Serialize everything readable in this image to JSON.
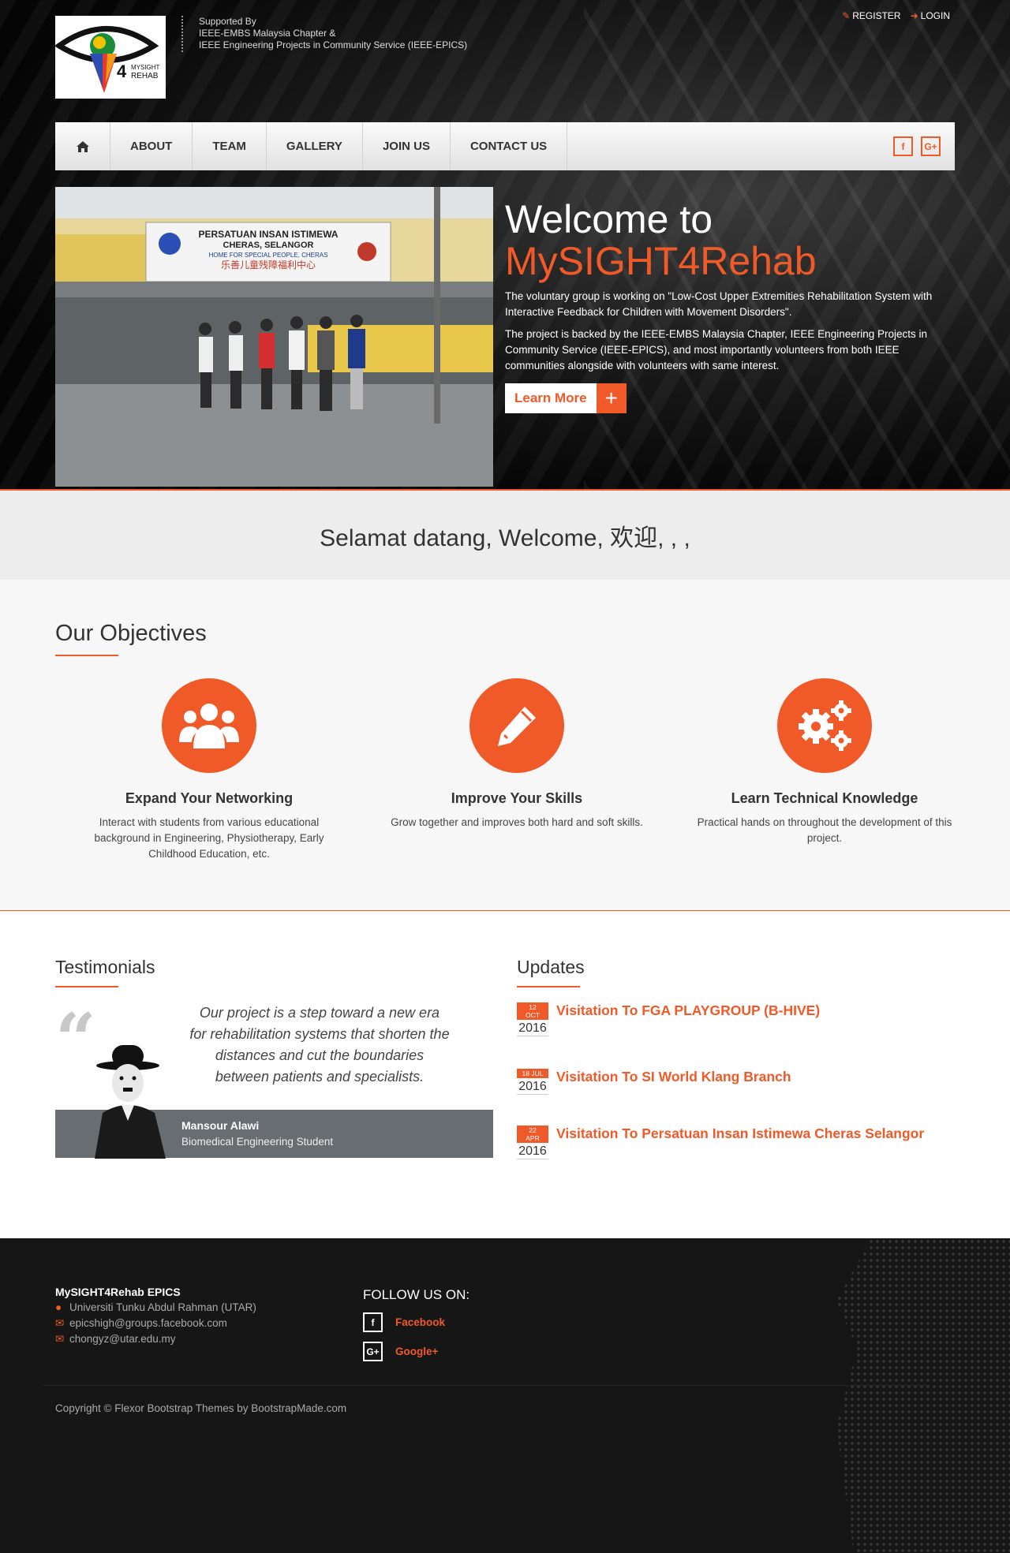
{
  "header": {
    "support_label": "Supported By",
    "support_line1": "IEEE-EMBS Malaysia Chapter &",
    "support_line2": "IEEE Engineering Projects in Community Service (IEEE-EPICS)",
    "logo_line1": "MYSIGHT",
    "logo_line2": "REHAB",
    "logo_number": "4",
    "register_label": "REGISTER",
    "login_label": "LOGIN"
  },
  "nav": {
    "items": [
      {
        "label": "ABOUT"
      },
      {
        "label": "TEAM"
      },
      {
        "label": "GALLERY"
      },
      {
        "label": "JOIN US"
      },
      {
        "label": "CONTACT US"
      }
    ],
    "facebook_glyph": "f",
    "googleplus_glyph": "G+"
  },
  "hero": {
    "title_line1": "Welcome to",
    "title_line2": "MySIGHT4Rehab",
    "para1": "The voluntary group is working on \"Low-Cost Upper Extremities Rehabilitation System with Interactive Feedback for Children with Movement Disorders\".",
    "para2": "The project is backed by the IEEE-EMBS Malaysia Chapter, IEEE Engineering Projects in Community Service (IEEE-EPICS), and most importantly volunteers from both IEEE communities alongside with volunteers with same interest.",
    "button_label": "Learn More",
    "photo_sign_line1": "PERSATUAN INSAN ISTIMEWA",
    "photo_sign_line2": "CHERAS, SELANGOR",
    "photo_sign_line3": "HOME FOR SPECIAL PEOPLE, CHERAS",
    "photo_sign_line4": "乐善儿童残障福利中心"
  },
  "welcome_bar": {
    "text": "Selamat datang, Welcome, 欢迎,         , ,"
  },
  "objectives": {
    "title": "Our Objectives",
    "items": [
      {
        "icon": "users-icon",
        "title": "Expand Your Networking",
        "desc": "Interact with students from various educational background in Engineering, Physiotherapy, Early Childhood Education, etc."
      },
      {
        "icon": "pencil-icon",
        "title": "Improve Your Skills",
        "desc": "Grow together and improves both hard and soft skills."
      },
      {
        "icon": "gears-icon",
        "title": "Learn Technical Knowledge",
        "desc": "Practical hands on throughout the development of this project."
      }
    ]
  },
  "testimonials": {
    "title": "Testimonials",
    "quote": "Our project is a step toward a new era for rehabilitation systems that shorten the distances and cut the boundaries between patients and specialists.",
    "name": "Mansour Alawi",
    "role": "Biomedical Engineering Student"
  },
  "updates": {
    "title": "Updates",
    "items": [
      {
        "day": "12",
        "month": "OCT",
        "year": "2016",
        "title": "Visitation To FGA PLAYGROUP (B-HIVE)"
      },
      {
        "day": "18 JUL",
        "month": "",
        "year": "2016",
        "title": "Visitation To SI World Klang Branch"
      },
      {
        "day": "22",
        "month": "APR",
        "year": "2016",
        "title": "Visitation To Persatuan Insan Istimewa Cheras Selangor"
      }
    ]
  },
  "footer": {
    "org": "MySIGHT4Rehab EPICS",
    "address": "Universiti Tunku Abdul Rahman (UTAR)",
    "email1": "epicshigh@groups.facebook.com",
    "email2": "chongyz@utar.edu.my",
    "follow_title": "FOLLOW US ON:",
    "facebook_label": "Facebook",
    "googleplus_label": "Google+",
    "copyright": "Copyright © Flexor Bootstrap Themes by BootstrapMade.com"
  },
  "colors": {
    "accent": "#f05a28",
    "footer_bg": "#161616",
    "testimonial_bar": "#686d72"
  }
}
